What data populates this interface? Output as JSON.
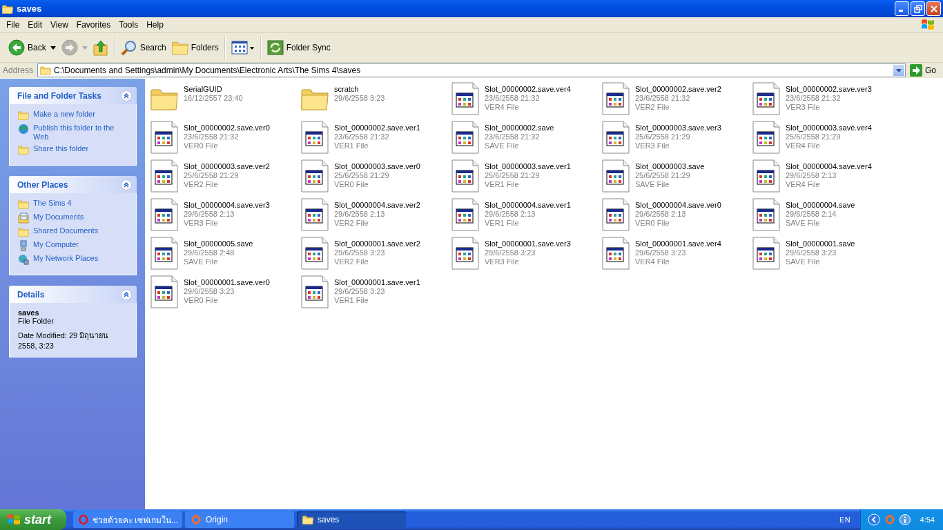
{
  "window": {
    "title": "saves"
  },
  "menu": [
    "File",
    "Edit",
    "View",
    "Favorites",
    "Tools",
    "Help"
  ],
  "toolbar": [
    {
      "kind": "back",
      "label": "Back",
      "disabled": false
    },
    {
      "kind": "forward",
      "disabled": true
    },
    {
      "kind": "up",
      "disabled": false
    },
    {
      "kind": "search",
      "label": "Search",
      "disabled": false
    },
    {
      "kind": "folders",
      "label": "Folders",
      "disabled": false
    },
    {
      "kind": "views",
      "disabled": false
    },
    {
      "kind": "sync",
      "label": "Folder Sync",
      "disabled": false
    }
  ],
  "address": {
    "label": "Address",
    "value": "C:\\Documents and Settings\\admin\\My Documents\\Electronic Arts\\The Sims 4\\saves",
    "go": "Go"
  },
  "sidebar": [
    {
      "kind": "links",
      "title": "File and Folder Tasks",
      "expanded": true,
      "items": [
        {
          "kind": "new-folder",
          "label": "Make a new folder"
        },
        {
          "kind": "globe",
          "label": "Publish this folder to the Web"
        },
        {
          "kind": "share",
          "label": "Share this folder"
        }
      ]
    },
    {
      "kind": "links",
      "title": "Other Places",
      "expanded": true,
      "items": [
        {
          "kind": "folder",
          "label": "The Sims 4"
        },
        {
          "kind": "documents",
          "label": "My Documents"
        },
        {
          "kind": "folder",
          "label": "Shared Documents"
        },
        {
          "kind": "computer",
          "label": "My Computer"
        },
        {
          "kind": "network",
          "label": "My Network Places"
        }
      ]
    },
    {
      "kind": "details",
      "title": "Details",
      "expanded": true,
      "name": "saves",
      "type": "File Folder",
      "modified": "Date Modified: 29 มิถุนายน 2558, 3:23"
    }
  ],
  "files": [
    {
      "kind": "folder",
      "name": "SerialGUID",
      "date": "16/12/2557 23:40"
    },
    {
      "kind": "folder",
      "name": "scratch",
      "date": "29/6/2558 3:23"
    },
    {
      "kind": "file",
      "name": "Slot_00000002.save.ver4",
      "date": "23/6/2558 21:32",
      "type": "VER4 File"
    },
    {
      "kind": "file",
      "name": "Slot_00000002.save.ver2",
      "date": "23/6/2558 21:32",
      "type": "VER2 File"
    },
    {
      "kind": "file",
      "name": "Slot_00000002.save.ver3",
      "date": "23/6/2558 21:32",
      "type": "VER3 File"
    },
    {
      "kind": "file",
      "name": "Slot_00000002.save.ver0",
      "date": "23/6/2558 21:32",
      "type": "VER0 File"
    },
    {
      "kind": "file",
      "name": "Slot_00000002.save.ver1",
      "date": "23/6/2558 21:32",
      "type": "VER1 File"
    },
    {
      "kind": "file",
      "name": "Slot_00000002.save",
      "date": "23/6/2558 21:32",
      "type": "SAVE File"
    },
    {
      "kind": "file",
      "name": "Slot_00000003.save.ver3",
      "date": "25/6/2558 21:29",
      "type": "VER3 File"
    },
    {
      "kind": "file",
      "name": "Slot_00000003.save.ver4",
      "date": "25/6/2558 21:29",
      "type": "VER4 File"
    },
    {
      "kind": "file",
      "name": "Slot_00000003.save.ver2",
      "date": "25/6/2558 21:29",
      "type": "VER2 File"
    },
    {
      "kind": "file",
      "name": "Slot_00000003.save.ver0",
      "date": "25/6/2558 21:29",
      "type": "VER0 File"
    },
    {
      "kind": "file",
      "name": "Slot_00000003.save.ver1",
      "date": "25/6/2558 21:29",
      "type": "VER1 File"
    },
    {
      "kind": "file",
      "name": "Slot_00000003.save",
      "date": "25/6/2558 21:29",
      "type": "SAVE File"
    },
    {
      "kind": "file",
      "name": "Slot_00000004.save.ver4",
      "date": "29/6/2558 2:13",
      "type": "VER4 File"
    },
    {
      "kind": "file",
      "name": "Slot_00000004.save.ver3",
      "date": "29/6/2558 2:13",
      "type": "VER3 File"
    },
    {
      "kind": "file",
      "name": "Slot_00000004.save.ver2",
      "date": "29/6/2558 2:13",
      "type": "VER2 File"
    },
    {
      "kind": "file",
      "name": "Slot_00000004.save.ver1",
      "date": "29/6/2558 2:13",
      "type": "VER1 File"
    },
    {
      "kind": "file",
      "name": "Slot_00000004.save.ver0",
      "date": "29/6/2558 2:13",
      "type": "VER0 File"
    },
    {
      "kind": "file",
      "name": "Slot_00000004.save",
      "date": "29/6/2558 2:14",
      "type": "SAVE File"
    },
    {
      "kind": "file",
      "name": "Slot_00000005.save",
      "date": "29/6/2558 2:48",
      "type": "SAVE File"
    },
    {
      "kind": "file",
      "name": "Slot_00000001.save.ver2",
      "date": "29/6/2558 3:23",
      "type": "VER2 File"
    },
    {
      "kind": "file",
      "name": "Slot_00000001.save.ver3",
      "date": "29/6/2558 3:23",
      "type": "VER3 File"
    },
    {
      "kind": "file",
      "name": "Slot_00000001.save.ver4",
      "date": "29/6/2558 3:23",
      "type": "VER4 File"
    },
    {
      "kind": "file",
      "name": "Slot_00000001.save",
      "date": "29/6/2558 3:23",
      "type": "SAVE File"
    },
    {
      "kind": "file",
      "name": "Slot_00000001.save.ver0",
      "date": "29/6/2558 3:23",
      "type": "VER0 File"
    },
    {
      "kind": "file",
      "name": "Slot_00000001.save.ver1",
      "date": "29/6/2558 3:23",
      "type": "VER1 File"
    }
  ],
  "taskbar": {
    "start": "start",
    "tasks": [
      {
        "kind": "opera",
        "label": "ช่วยด้วยคะ เซฟเกมใน...",
        "selected": false
      },
      {
        "kind": "origin",
        "label": "Origin",
        "selected": false
      },
      {
        "kind": "folder",
        "label": "saves",
        "selected": true
      }
    ],
    "language": "EN",
    "clock": "4:54"
  }
}
